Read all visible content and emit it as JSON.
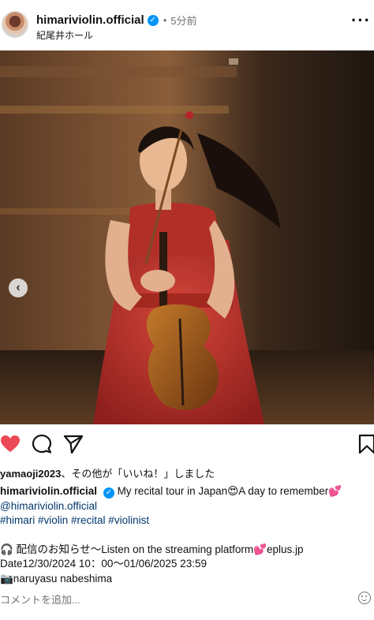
{
  "post": {
    "username": "himariviolin.official",
    "verified_mark": "✓",
    "dot": "•",
    "time": "5分前",
    "location": "紀尾井ホール",
    "more_label": "···"
  },
  "media": {
    "prev_label": "‹",
    "photo_subject": "girl in red dress holding violin on stage"
  },
  "actions": {
    "like_icon": "heart-filled-icon",
    "comment_icon": "comment-icon",
    "share_icon": "paper-plane-icon",
    "save_icon": "bookmark-icon",
    "like_color": "#ed4956"
  },
  "likes": {
    "user": "yamaoji2023",
    "rest": "、その他が「いいね！」しました"
  },
  "caption": {
    "username": "himariviolin.official",
    "line1": "My recital tour in Japan😍A day to remember💕",
    "mention": "@himariviolin.official",
    "hashtags": "#himari #violin #recital #violinist",
    "line4": "🎧 配信のお知らせ〜Listen on the streaming platform💕eplus.jp",
    "line5": "Date12/30/2024 10：00〜01/06/2025 23:59",
    "line6": "📷naruyasu nabeshima"
  },
  "comment": {
    "placeholder": "コメントを追加..."
  }
}
